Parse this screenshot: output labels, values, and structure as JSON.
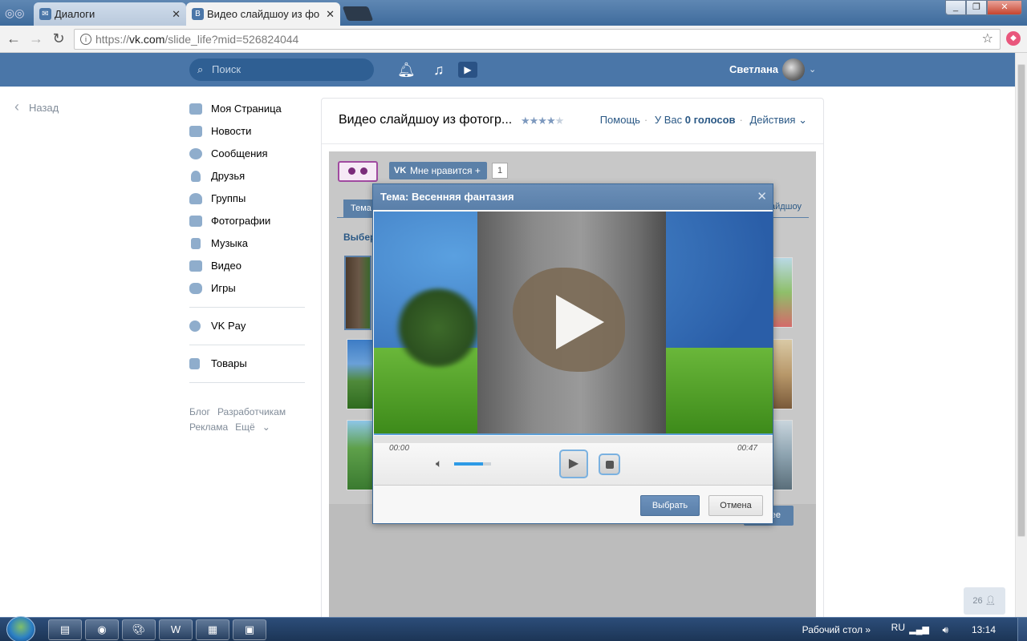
{
  "browser": {
    "tabs": [
      {
        "title": "Диалоги",
        "icon": "vk-messages-icon"
      },
      {
        "title": "Видео слайдшоу из фото",
        "icon": "vk-logo-icon"
      }
    ],
    "tab_close": "✕",
    "url_prefix": "https://",
    "url_host": "vk.com",
    "url_path": "/slide_life?mid=526824044"
  },
  "header": {
    "search_placeholder": "Поиск",
    "user_name": "Светлана"
  },
  "sidebar": {
    "back_label": "Назад",
    "items": [
      {
        "label": "Моя Страница",
        "icon": "home-icon"
      },
      {
        "label": "Новости",
        "icon": "news-icon"
      },
      {
        "label": "Сообщения",
        "icon": "messages-icon"
      },
      {
        "label": "Друзья",
        "icon": "friends-icon"
      },
      {
        "label": "Группы",
        "icon": "groups-icon"
      },
      {
        "label": "Фотографии",
        "icon": "camera-icon"
      },
      {
        "label": "Музыка",
        "icon": "music-icon"
      },
      {
        "label": "Видео",
        "icon": "video-icon"
      },
      {
        "label": "Игры",
        "icon": "games-icon"
      }
    ],
    "pay_label": "VK Pay",
    "market_label": "Товары",
    "footer": {
      "blog": "Блог",
      "dev": "Разработчикам",
      "ads": "Реклама",
      "more": "Ещё"
    }
  },
  "app": {
    "title": "Видео слайдшоу из фотогр...",
    "rating_stars": 4,
    "links": {
      "help": "Помощь",
      "votes_prefix": "У Вас",
      "votes": "0 голосов",
      "actions": "Действия"
    },
    "like_label": "Мне нравится +",
    "like_count": "1",
    "tab_label": "Тема",
    "tab_right_label": "айдшоу",
    "choose_label": "Выбер",
    "bg_button_label": "ее"
  },
  "modal": {
    "title": "Тема: Весенняя фантазия",
    "time_start": "00:00",
    "time_end": "00:47",
    "volume_fraction": 0.78,
    "select_label": "Выбрать",
    "cancel_label": "Отмена"
  },
  "online_count": "26",
  "taskbar": {
    "desktop_label": "Рабочий стол",
    "language": "RU",
    "clock": "13:14"
  },
  "colors": {
    "vk_blue": "#4a76a8",
    "sidebar_text": "#000000",
    "link_blue": "#2a5885"
  }
}
